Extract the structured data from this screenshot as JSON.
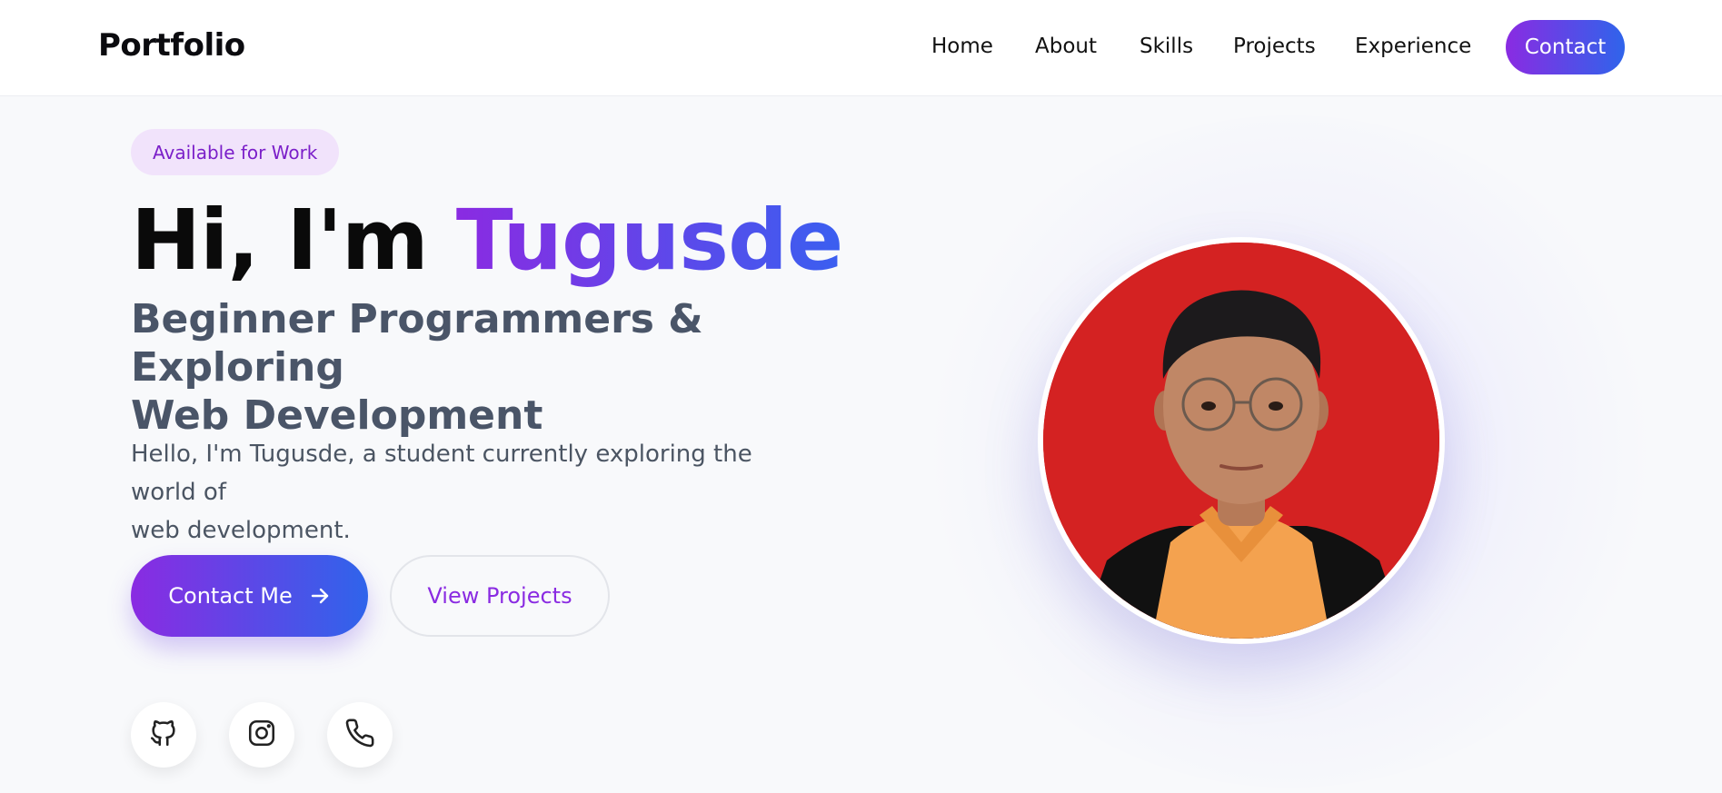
{
  "header": {
    "brand": "Portfolio",
    "nav": [
      "Home",
      "About",
      "Skills",
      "Projects",
      "Experience"
    ],
    "contact_label": "Contact"
  },
  "hero": {
    "badge": "Available for Work",
    "greeting": "Hi, I'm ",
    "name": "Tugusde",
    "subtitle_line1": "Beginner Programmers & Exploring",
    "subtitle_line2": "Web Development",
    "intro_line1": "Hello, I'm Tugusde, a student currently exploring the world of",
    "intro_line2": "web development.",
    "primary_button": "Contact Me",
    "secondary_button": "View Projects",
    "socials": [
      "github-icon",
      "instagram-icon",
      "phone-icon"
    ]
  },
  "colors": {
    "accent_start": "#8a2be2",
    "accent_end": "#2f64eb",
    "badge_bg": "#f1e3fb",
    "avatar_bg": "#d42222"
  }
}
